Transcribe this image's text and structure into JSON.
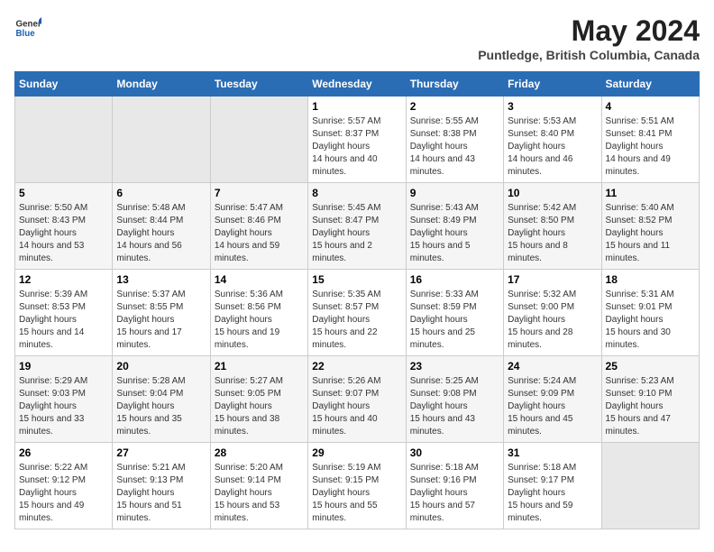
{
  "header": {
    "logo": {
      "general": "General",
      "blue": "Blue"
    },
    "title": "May 2024",
    "location": "Puntledge, British Columbia, Canada"
  },
  "calendar": {
    "headers": [
      "Sunday",
      "Monday",
      "Tuesday",
      "Wednesday",
      "Thursday",
      "Friday",
      "Saturday"
    ],
    "weeks": [
      [
        {
          "day": "",
          "empty": true
        },
        {
          "day": "",
          "empty": true
        },
        {
          "day": "",
          "empty": true
        },
        {
          "day": "1",
          "sunrise": "5:57 AM",
          "sunset": "8:37 PM",
          "daylight": "14 hours and 40 minutes."
        },
        {
          "day": "2",
          "sunrise": "5:55 AM",
          "sunset": "8:38 PM",
          "daylight": "14 hours and 43 minutes."
        },
        {
          "day": "3",
          "sunrise": "5:53 AM",
          "sunset": "8:40 PM",
          "daylight": "14 hours and 46 minutes."
        },
        {
          "day": "4",
          "sunrise": "5:51 AM",
          "sunset": "8:41 PM",
          "daylight": "14 hours and 49 minutes."
        }
      ],
      [
        {
          "day": "5",
          "sunrise": "5:50 AM",
          "sunset": "8:43 PM",
          "daylight": "14 hours and 53 minutes."
        },
        {
          "day": "6",
          "sunrise": "5:48 AM",
          "sunset": "8:44 PM",
          "daylight": "14 hours and 56 minutes."
        },
        {
          "day": "7",
          "sunrise": "5:47 AM",
          "sunset": "8:46 PM",
          "daylight": "14 hours and 59 minutes."
        },
        {
          "day": "8",
          "sunrise": "5:45 AM",
          "sunset": "8:47 PM",
          "daylight": "15 hours and 2 minutes."
        },
        {
          "day": "9",
          "sunrise": "5:43 AM",
          "sunset": "8:49 PM",
          "daylight": "15 hours and 5 minutes."
        },
        {
          "day": "10",
          "sunrise": "5:42 AM",
          "sunset": "8:50 PM",
          "daylight": "15 hours and 8 minutes."
        },
        {
          "day": "11",
          "sunrise": "5:40 AM",
          "sunset": "8:52 PM",
          "daylight": "15 hours and 11 minutes."
        }
      ],
      [
        {
          "day": "12",
          "sunrise": "5:39 AM",
          "sunset": "8:53 PM",
          "daylight": "15 hours and 14 minutes."
        },
        {
          "day": "13",
          "sunrise": "5:37 AM",
          "sunset": "8:55 PM",
          "daylight": "15 hours and 17 minutes."
        },
        {
          "day": "14",
          "sunrise": "5:36 AM",
          "sunset": "8:56 PM",
          "daylight": "15 hours and 19 minutes."
        },
        {
          "day": "15",
          "sunrise": "5:35 AM",
          "sunset": "8:57 PM",
          "daylight": "15 hours and 22 minutes."
        },
        {
          "day": "16",
          "sunrise": "5:33 AM",
          "sunset": "8:59 PM",
          "daylight": "15 hours and 25 minutes."
        },
        {
          "day": "17",
          "sunrise": "5:32 AM",
          "sunset": "9:00 PM",
          "daylight": "15 hours and 28 minutes."
        },
        {
          "day": "18",
          "sunrise": "5:31 AM",
          "sunset": "9:01 PM",
          "daylight": "15 hours and 30 minutes."
        }
      ],
      [
        {
          "day": "19",
          "sunrise": "5:29 AM",
          "sunset": "9:03 PM",
          "daylight": "15 hours and 33 minutes."
        },
        {
          "day": "20",
          "sunrise": "5:28 AM",
          "sunset": "9:04 PM",
          "daylight": "15 hours and 35 minutes."
        },
        {
          "day": "21",
          "sunrise": "5:27 AM",
          "sunset": "9:05 PM",
          "daylight": "15 hours and 38 minutes."
        },
        {
          "day": "22",
          "sunrise": "5:26 AM",
          "sunset": "9:07 PM",
          "daylight": "15 hours and 40 minutes."
        },
        {
          "day": "23",
          "sunrise": "5:25 AM",
          "sunset": "9:08 PM",
          "daylight": "15 hours and 43 minutes."
        },
        {
          "day": "24",
          "sunrise": "5:24 AM",
          "sunset": "9:09 PM",
          "daylight": "15 hours and 45 minutes."
        },
        {
          "day": "25",
          "sunrise": "5:23 AM",
          "sunset": "9:10 PM",
          "daylight": "15 hours and 47 minutes."
        }
      ],
      [
        {
          "day": "26",
          "sunrise": "5:22 AM",
          "sunset": "9:12 PM",
          "daylight": "15 hours and 49 minutes."
        },
        {
          "day": "27",
          "sunrise": "5:21 AM",
          "sunset": "9:13 PM",
          "daylight": "15 hours and 51 minutes."
        },
        {
          "day": "28",
          "sunrise": "5:20 AM",
          "sunset": "9:14 PM",
          "daylight": "15 hours and 53 minutes."
        },
        {
          "day": "29",
          "sunrise": "5:19 AM",
          "sunset": "9:15 PM",
          "daylight": "15 hours and 55 minutes."
        },
        {
          "day": "30",
          "sunrise": "5:18 AM",
          "sunset": "9:16 PM",
          "daylight": "15 hours and 57 minutes."
        },
        {
          "day": "31",
          "sunrise": "5:18 AM",
          "sunset": "9:17 PM",
          "daylight": "15 hours and 59 minutes."
        },
        {
          "day": "",
          "empty": true
        }
      ]
    ]
  }
}
